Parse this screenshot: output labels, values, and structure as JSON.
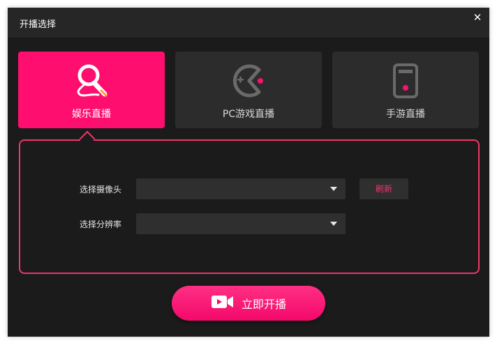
{
  "window": {
    "title": "开播选择",
    "close_icon": "✕"
  },
  "modes": [
    {
      "label": "娱乐直播",
      "icon": "magnifier-microphone-icon",
      "active": true
    },
    {
      "label": "PC游戏直播",
      "icon": "pacman-icon",
      "active": false
    },
    {
      "label": "手游直播",
      "icon": "mobile-phone-icon",
      "active": false
    }
  ],
  "settings": {
    "camera_label": "选择摄像头",
    "camera_value": "",
    "resolution_label": "选择分辨率",
    "resolution_value": "",
    "refresh_label": "刷新"
  },
  "start_button": {
    "label": "立即开播",
    "icon": "video-camera-icon"
  },
  "colors": {
    "accent": "#fe0f6f",
    "panel_border": "#f0366b",
    "background": "#1b1b1b",
    "card": "#2c2c2c"
  }
}
